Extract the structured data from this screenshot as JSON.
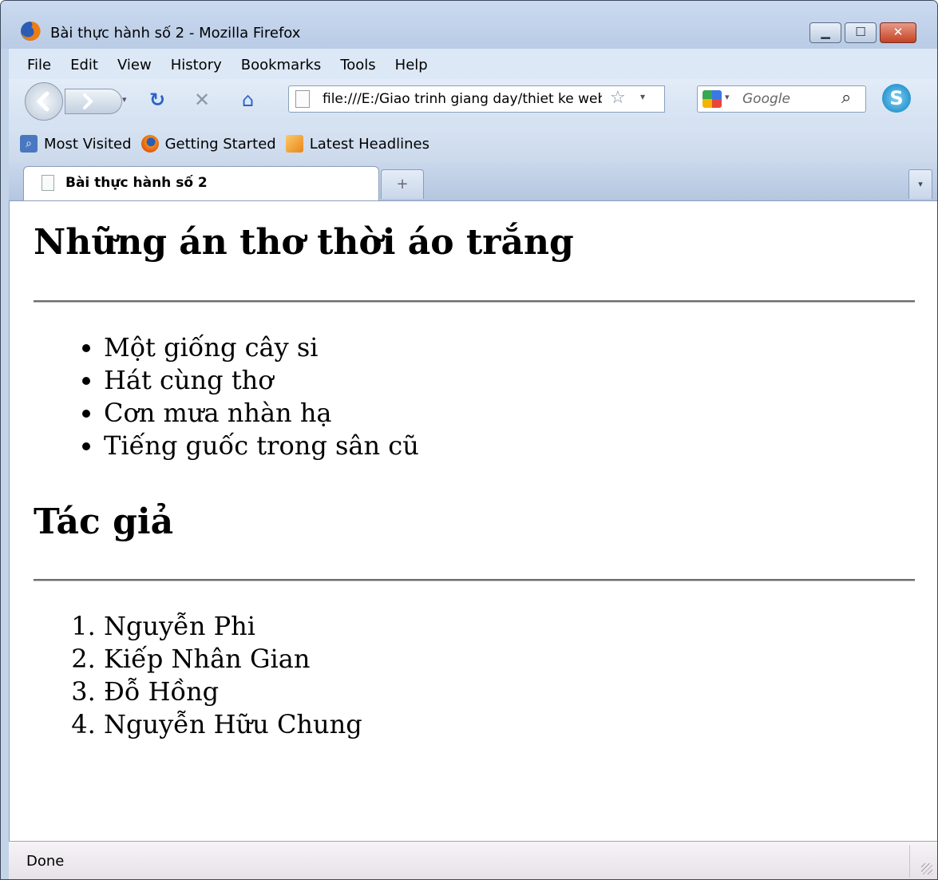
{
  "window": {
    "title": "Bài thực hành số 2 - Mozilla Firefox",
    "caption_buttons": {
      "minimize": "▁",
      "maximize": "☐",
      "close": "✕"
    }
  },
  "menubar": {
    "items": [
      "File",
      "Edit",
      "View",
      "History",
      "Bookmarks",
      "Tools",
      "Help"
    ]
  },
  "navbar": {
    "url": "file:///E:/Giao trinh giang day/thiet ke web/",
    "search_placeholder": "Google",
    "icons": {
      "back": "back-icon",
      "forward": "forward-icon",
      "reload": "reload-icon",
      "stop": "stop-icon",
      "home": "home-icon",
      "bookmark_star": "star-icon",
      "search_go": "magnifier-icon",
      "skype": "skype-icon"
    }
  },
  "bookmarks": {
    "items": [
      {
        "label": "Most Visited",
        "icon": "most-visited-icon"
      },
      {
        "label": "Getting Started",
        "icon": "firefox-icon"
      },
      {
        "label": "Latest Headlines",
        "icon": "rss-feed-icon"
      }
    ]
  },
  "tabs": {
    "active_label": "Bài thực hành số 2",
    "new_tab_glyph": "+",
    "list_glyph": "▾"
  },
  "page": {
    "heading1": "Những án thơ thời áo trắng",
    "list1": [
      "Một giống cây si",
      "Hát cùng thơ",
      "Cơn mưa nhàn hạ",
      "Tiếng guốc trong sân cũ"
    ],
    "heading2": "Tác giả",
    "list2": [
      "Nguyễn Phi",
      "Kiếp Nhân Gian",
      "Đỗ Hồng",
      "Nguyễn Hữu Chung"
    ]
  },
  "status": {
    "text": "Done"
  },
  "colors": {
    "chrome": "#c3d3e8",
    "close_button": "#c44225",
    "text": "#000000"
  }
}
